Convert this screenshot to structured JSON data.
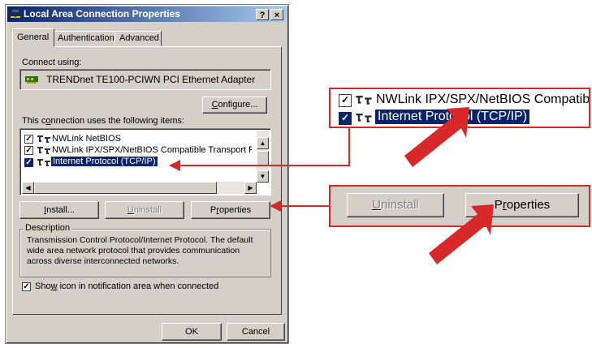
{
  "window": {
    "title": "Local Area Connection Properties",
    "help_label": "?",
    "close_label": "×"
  },
  "tabs": [
    {
      "label": "General",
      "selected": true
    },
    {
      "label": "Authentication",
      "selected": false
    },
    {
      "label": "Advanced",
      "selected": false
    }
  ],
  "connect_using": {
    "label": "Connect using:",
    "adapter": "TRENDnet TE100-PCIWN PCI Ethernet Adapter"
  },
  "configure_button": {
    "pre": "",
    "accel": "C",
    "post": "onfigure..."
  },
  "items_label": {
    "pre": "This c",
    "accel": "o",
    "post": "nnection uses the following items:"
  },
  "items": [
    {
      "label": "NWLink NetBIOS",
      "checked": true,
      "selected": false
    },
    {
      "label": "NWLink IPX/SPX/NetBIOS Compatible Transport Proto",
      "checked": true,
      "selected": false
    },
    {
      "label": "Internet Protocol (TCP/IP)",
      "checked": true,
      "selected": true
    }
  ],
  "buttons": {
    "install": {
      "pre": "",
      "accel": "I",
      "post": "nstall..."
    },
    "uninstall": {
      "pre": "",
      "accel": "U",
      "post": "ninstall"
    },
    "properties": {
      "pre": "P",
      "accel": "r",
      "post": "operties"
    }
  },
  "description": {
    "label": "Description",
    "lines": [
      "Transmission Control Protocol/Internet Protocol. The default",
      "wide area network protocol that provides communication",
      "across diverse interconnected networks."
    ]
  },
  "show_icon": {
    "pre": "Sho",
    "accel": "w",
    "post": " icon in notification area when connected",
    "checked": true
  },
  "footer": {
    "ok": "OK",
    "cancel": "Cancel"
  },
  "zoom_top": {
    "items": [
      {
        "label": "NWLink IPX/SPX/NetBIOS Compatib",
        "checked": true,
        "selected": false
      },
      {
        "label": "Internet Protocol (TCP/IP)",
        "checked": true,
        "selected": true
      }
    ]
  },
  "zoom_bottom": {
    "uninstall": {
      "pre": "",
      "accel": "U",
      "post": "ninstall"
    },
    "properties": {
      "pre": "P",
      "accel": "r",
      "post": "operties"
    }
  },
  "colors": {
    "callout": "#d8282a",
    "title_start": "#0a246a",
    "title_end": "#a6caf0",
    "selection": "#0a246a"
  }
}
